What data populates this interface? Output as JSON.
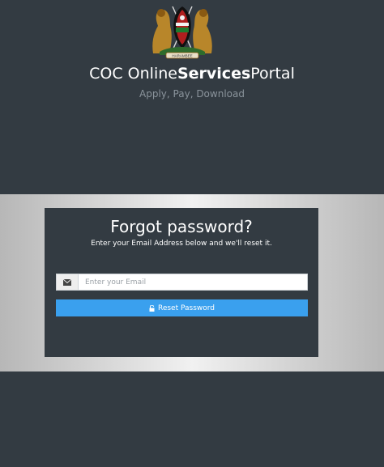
{
  "header": {
    "title_prefix": "COC Online",
    "title_bold": "Services",
    "title_suffix": "Portal",
    "tagline": "Apply, Pay, Download",
    "emblem_icon": "kenya-coat-of-arms",
    "emblem_motto": "HARAMBEE"
  },
  "form": {
    "title": "Forgot password?",
    "subtitle": "Enter your Email Address below and we'll reset it.",
    "email_placeholder": "Enter your Email",
    "email_value": "",
    "email_icon": "envelope-icon",
    "reset_label": "Reset Password",
    "reset_icon": "unlock-icon"
  },
  "colors": {
    "background": "#333b42",
    "accent": "#3aa0ee",
    "band_light": "#f1f1f1"
  }
}
